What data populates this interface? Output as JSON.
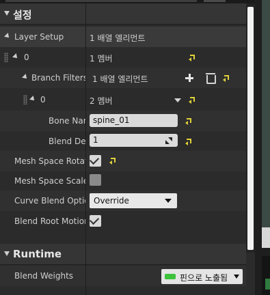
{
  "categories": {
    "settings": "설정",
    "runtime": "Runtime"
  },
  "rows": {
    "layer_setup": {
      "label": "Layer Setup",
      "value": "1 배열 엘리먼트"
    },
    "index0": {
      "label": "0",
      "value": "1 멤버"
    },
    "branch_filters": {
      "label": "Branch Filters",
      "value": "1 배열 엘리먼트"
    },
    "bf_index0": {
      "label": "0",
      "value": "2 멤버"
    },
    "bone_name": {
      "label": "Bone Name",
      "value": "spine_01"
    },
    "blend_depth": {
      "label": "Blend Depth",
      "value": "1"
    },
    "mesh_space_rotation": {
      "label": "Mesh Space Rotation Blend",
      "checked": true
    },
    "mesh_space_scale": {
      "label": "Mesh Space Scale Blend",
      "checked": false
    },
    "curve_blend_option": {
      "label": "Curve Blend Option",
      "value": "Override"
    },
    "blend_root_motion": {
      "label": "Blend Root Motion Based on Root Bone",
      "checked": true
    },
    "blend_weights": {
      "label": "Blend Weights",
      "value": "핀으로 노출됨"
    }
  },
  "colors": {
    "reset_arrow": "#e2d33a",
    "pin_indicator": "#3cc33c"
  },
  "icons": [
    "collapse-arrow-icon",
    "reset-to-default-icon",
    "add-element-icon",
    "delete-icon",
    "checkmark-icon",
    "drag-handle-icon",
    "dropdown-caret-icon",
    "exposed-pin-icon",
    "spin-icon"
  ]
}
